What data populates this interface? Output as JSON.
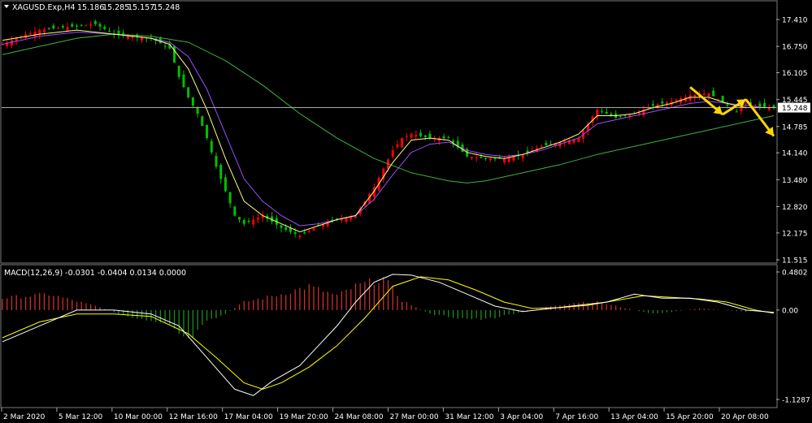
{
  "chart_data": [
    {
      "type": "candlestick",
      "symbol_header": "XAGUSD.Exp,H4",
      "ohlc_header": [
        "15.186",
        "15.285",
        "15.157",
        "15.248"
      ],
      "current_price": "15.248",
      "ylim": [
        11.515,
        17.41
      ],
      "y_ticks": [
        "17.410",
        "16.750",
        "16.105",
        "15.445",
        "14.785",
        "14.140",
        "13.480",
        "12.820",
        "12.175",
        "11.515"
      ],
      "x_ticks": [
        "2 Mar 2020",
        "5 Mar 12:00",
        "10 Mar 00:00",
        "12 Mar 16:00",
        "17 Mar 04:00",
        "19 Mar 20:00",
        "24 Mar 08:00",
        "27 Mar 00:00",
        "31 Mar 12:00",
        "3 Apr 04:00",
        "7 Apr 16:00",
        "13 Apr 04:00",
        "15 Apr 20:00",
        "20 Apr 08:00"
      ],
      "price_path": [
        [
          0,
          16.8
        ],
        [
          4,
          17.0
        ],
        [
          8,
          17.15
        ],
        [
          12,
          17.2
        ],
        [
          16,
          17.25
        ],
        [
          20,
          17.3
        ],
        [
          24,
          17.05
        ],
        [
          28,
          17.0
        ],
        [
          32,
          16.95
        ],
        [
          36,
          16.7
        ],
        [
          38,
          16.0
        ],
        [
          40,
          15.5
        ],
        [
          42,
          15.1
        ],
        [
          44,
          14.5
        ],
        [
          46,
          13.8
        ],
        [
          48,
          13.2
        ],
        [
          50,
          12.6
        ],
        [
          52,
          12.4
        ],
        [
          56,
          12.6
        ],
        [
          60,
          12.3
        ],
        [
          64,
          12.1
        ],
        [
          68,
          12.35
        ],
        [
          72,
          12.5
        ],
        [
          76,
          12.6
        ],
        [
          80,
          13.3
        ],
        [
          84,
          14.2
        ],
        [
          86,
          14.5
        ],
        [
          88,
          14.6
        ],
        [
          92,
          14.5
        ],
        [
          96,
          14.5
        ],
        [
          100,
          14.05
        ],
        [
          104,
          14.0
        ],
        [
          108,
          14.0
        ],
        [
          112,
          14.1
        ],
        [
          116,
          14.3
        ],
        [
          120,
          14.4
        ],
        [
          124,
          14.5
        ],
        [
          128,
          15.2
        ],
        [
          132,
          15.0
        ],
        [
          136,
          15.1
        ],
        [
          140,
          15.3
        ],
        [
          144,
          15.4
        ],
        [
          148,
          15.55
        ],
        [
          152,
          15.6
        ],
        [
          154,
          15.45
        ],
        [
          156,
          15.3
        ],
        [
          158,
          15.15
        ],
        [
          160,
          15.35
        ],
        [
          162,
          15.3
        ],
        [
          164,
          15.25
        ],
        [
          166,
          15.248
        ]
      ],
      "ma_fast_path": [
        [
          0,
          16.9
        ],
        [
          8,
          17.05
        ],
        [
          16,
          17.15
        ],
        [
          24,
          17.05
        ],
        [
          32,
          16.95
        ],
        [
          36,
          16.8
        ],
        [
          40,
          16.2
        ],
        [
          44,
          15.2
        ],
        [
          48,
          14.0
        ],
        [
          52,
          12.95
        ],
        [
          56,
          12.6
        ],
        [
          60,
          12.4
        ],
        [
          64,
          12.2
        ],
        [
          68,
          12.35
        ],
        [
          72,
          12.5
        ],
        [
          76,
          12.6
        ],
        [
          80,
          13.2
        ],
        [
          84,
          13.9
        ],
        [
          88,
          14.45
        ],
        [
          92,
          14.5
        ],
        [
          96,
          14.45
        ],
        [
          100,
          14.15
        ],
        [
          104,
          14.05
        ],
        [
          108,
          14.0
        ],
        [
          112,
          14.1
        ],
        [
          116,
          14.25
        ],
        [
          120,
          14.4
        ],
        [
          124,
          14.6
        ],
        [
          128,
          15.05
        ],
        [
          132,
          15.05
        ],
        [
          136,
          15.1
        ],
        [
          140,
          15.25
        ],
        [
          144,
          15.35
        ],
        [
          148,
          15.5
        ],
        [
          152,
          15.5
        ],
        [
          156,
          15.35
        ],
        [
          160,
          15.25
        ],
        [
          164,
          15.25
        ],
        [
          166,
          15.25
        ]
      ],
      "ma_mid_path": [
        [
          0,
          16.8
        ],
        [
          8,
          17.0
        ],
        [
          16,
          17.1
        ],
        [
          24,
          17.05
        ],
        [
          32,
          16.95
        ],
        [
          36,
          16.85
        ],
        [
          40,
          16.5
        ],
        [
          44,
          15.7
        ],
        [
          48,
          14.6
        ],
        [
          52,
          13.5
        ],
        [
          56,
          12.95
        ],
        [
          60,
          12.6
        ],
        [
          64,
          12.35
        ],
        [
          68,
          12.4
        ],
        [
          72,
          12.5
        ],
        [
          76,
          12.6
        ],
        [
          80,
          13.0
        ],
        [
          84,
          13.6
        ],
        [
          88,
          14.15
        ],
        [
          92,
          14.35
        ],
        [
          96,
          14.4
        ],
        [
          100,
          14.2
        ],
        [
          104,
          14.1
        ],
        [
          108,
          14.05
        ],
        [
          112,
          14.1
        ],
        [
          116,
          14.2
        ],
        [
          120,
          14.35
        ],
        [
          124,
          14.5
        ],
        [
          128,
          14.85
        ],
        [
          132,
          14.95
        ],
        [
          136,
          15.05
        ],
        [
          140,
          15.15
        ],
        [
          144,
          15.25
        ],
        [
          148,
          15.35
        ],
        [
          152,
          15.4
        ],
        [
          156,
          15.35
        ],
        [
          160,
          15.3
        ],
        [
          164,
          15.25
        ],
        [
          166,
          15.25
        ]
      ],
      "ma_slow_path": [
        [
          0,
          16.55
        ],
        [
          8,
          16.75
        ],
        [
          16,
          16.95
        ],
        [
          24,
          17.05
        ],
        [
          32,
          17.0
        ],
        [
          40,
          16.85
        ],
        [
          48,
          16.4
        ],
        [
          56,
          15.8
        ],
        [
          64,
          15.1
        ],
        [
          72,
          14.5
        ],
        [
          80,
          14.0
        ],
        [
          88,
          13.65
        ],
        [
          96,
          13.45
        ],
        [
          100,
          13.4
        ],
        [
          104,
          13.45
        ],
        [
          112,
          13.65
        ],
        [
          120,
          13.85
        ],
        [
          128,
          14.1
        ],
        [
          136,
          14.3
        ],
        [
          144,
          14.5
        ],
        [
          152,
          14.7
        ],
        [
          160,
          14.9
        ],
        [
          166,
          15.05
        ]
      ],
      "annotations": [
        {
          "type": "arrow",
          "from": [
            148,
            15.75
          ],
          "to": [
            155,
            15.08
          ]
        },
        {
          "type": "arrow",
          "from": [
            155,
            15.08
          ],
          "to": [
            160,
            15.45
          ]
        },
        {
          "type": "arrow",
          "from": [
            160,
            15.45
          ],
          "to": [
            166,
            14.55
          ]
        }
      ],
      "colors": {
        "up": "#ff0000",
        "down": "#00c000",
        "ma_fast": "#ffff80",
        "ma_mid": "#9b4dff",
        "ma_slow": "#3cb43c",
        "arrows": "#ffd700",
        "price_line": "#c0c0c0"
      }
    },
    {
      "type": "histogram",
      "title": "MACD(12,26,9) -0.0301 -0.0404 0.0134 0.0000",
      "ylim": [
        -1.1287,
        0.4802
      ],
      "y_ticks": [
        "0.4802",
        "0.00",
        "-1.1287"
      ],
      "hist_path": [
        [
          0,
          0.15
        ],
        [
          10,
          0.2
        ],
        [
          20,
          0.05
        ],
        [
          28,
          -0.1
        ],
        [
          36,
          -0.2
        ],
        [
          40,
          -0.4
        ],
        [
          44,
          -0.15
        ],
        [
          48,
          -0.05
        ],
        [
          52,
          0.1
        ],
        [
          60,
          0.2
        ],
        [
          66,
          0.3
        ],
        [
          72,
          0.18
        ],
        [
          76,
          0.3
        ],
        [
          82,
          0.4
        ],
        [
          86,
          0.12
        ],
        [
          92,
          -0.05
        ],
        [
          98,
          -0.1
        ],
        [
          104,
          -0.12
        ],
        [
          110,
          -0.05
        ],
        [
          118,
          0.05
        ],
        [
          124,
          0.1
        ],
        [
          128,
          0.1
        ],
        [
          132,
          0.05
        ],
        [
          140,
          -0.05
        ],
        [
          150,
          0.02
        ],
        [
          160,
          -0.02
        ],
        [
          166,
          0.0
        ]
      ],
      "macd_path": [
        [
          0,
          -0.4
        ],
        [
          8,
          -0.2
        ],
        [
          16,
          0.0
        ],
        [
          24,
          0.0
        ],
        [
          32,
          -0.05
        ],
        [
          38,
          -0.2
        ],
        [
          44,
          -0.6
        ],
        [
          50,
          -1.0
        ],
        [
          54,
          -1.08
        ],
        [
          58,
          -0.9
        ],
        [
          64,
          -0.7
        ],
        [
          68,
          -0.45
        ],
        [
          72,
          -0.2
        ],
        [
          76,
          0.1
        ],
        [
          80,
          0.35
        ],
        [
          84,
          0.45
        ],
        [
          88,
          0.44
        ],
        [
          94,
          0.35
        ],
        [
          100,
          0.2
        ],
        [
          106,
          0.05
        ],
        [
          112,
          -0.02
        ],
        [
          118,
          0.02
        ],
        [
          124,
          0.06
        ],
        [
          130,
          0.1
        ],
        [
          136,
          0.2
        ],
        [
          142,
          0.15
        ],
        [
          148,
          0.15
        ],
        [
          154,
          0.1
        ],
        [
          160,
          0.0
        ],
        [
          166,
          -0.03
        ]
      ],
      "signal_path": [
        [
          0,
          -0.35
        ],
        [
          8,
          -0.15
        ],
        [
          16,
          -0.05
        ],
        [
          24,
          -0.05
        ],
        [
          32,
          -0.08
        ],
        [
          40,
          -0.3
        ],
        [
          46,
          -0.6
        ],
        [
          52,
          -0.92
        ],
        [
          56,
          -1.0
        ],
        [
          60,
          -0.92
        ],
        [
          66,
          -0.72
        ],
        [
          72,
          -0.45
        ],
        [
          78,
          -0.1
        ],
        [
          84,
          0.3
        ],
        [
          90,
          0.42
        ],
        [
          96,
          0.38
        ],
        [
          102,
          0.25
        ],
        [
          108,
          0.1
        ],
        [
          114,
          0.02
        ],
        [
          120,
          0.03
        ],
        [
          126,
          0.06
        ],
        [
          132,
          0.12
        ],
        [
          138,
          0.18
        ],
        [
          144,
          0.16
        ],
        [
          150,
          0.14
        ],
        [
          156,
          0.1
        ],
        [
          162,
          0.0
        ],
        [
          166,
          -0.04
        ]
      ],
      "colors": {
        "hist_pos": "#c83228",
        "hist_neg": "#1e8c1e",
        "macd_line": "#ffffff",
        "signal_line": "#ffff00"
      }
    }
  ]
}
